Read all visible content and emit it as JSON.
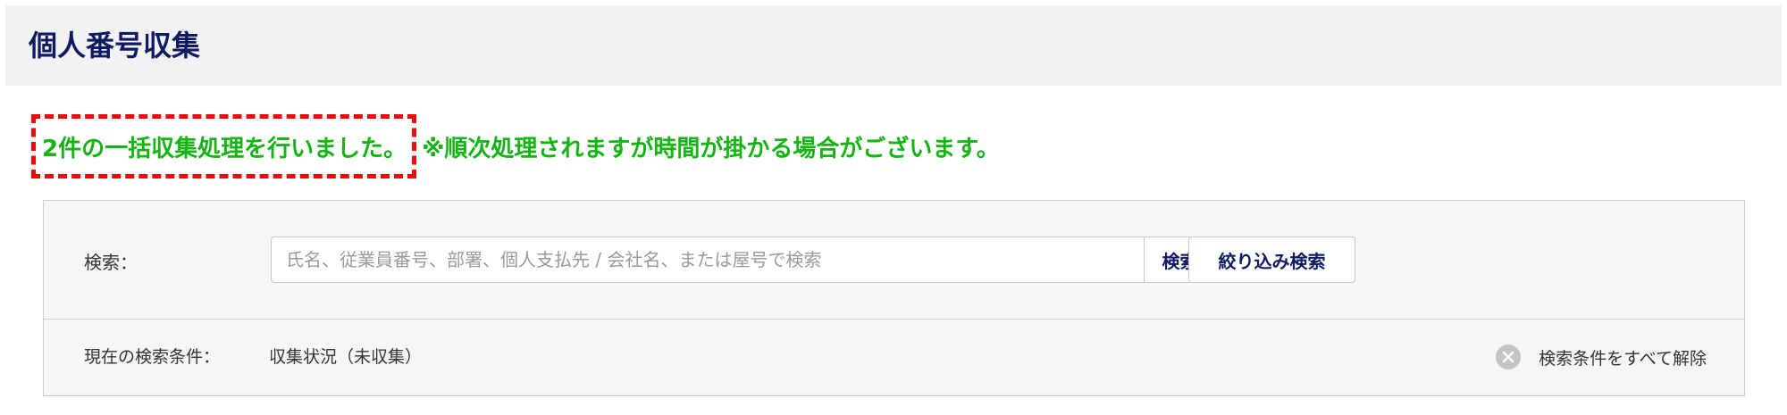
{
  "header": {
    "title": "個人番号収集"
  },
  "message": {
    "highlight": "2件の一括収集処理を行いました。",
    "note": "※順次処理されますが時間が掛かる場合がございます。"
  },
  "search": {
    "label": "検索：",
    "placeholder": "氏名、従業員番号、部署、個人支払先 / 会社名、または屋号で検索",
    "value": "",
    "search_button_label": "検索",
    "filter_button_label": "絞り込み検索"
  },
  "conditions": {
    "label": "現在の検索条件：",
    "value": "収集状況（未収集）",
    "clear_label": "検索条件をすべて解除"
  },
  "colors": {
    "title": "#101a63",
    "success_text": "#15b415",
    "highlight_border": "#ee0a0a",
    "header_bg": "#f2f2f2",
    "panel_bg": "#f6f6f6"
  },
  "icons": {
    "clear": "close-circle-icon"
  }
}
